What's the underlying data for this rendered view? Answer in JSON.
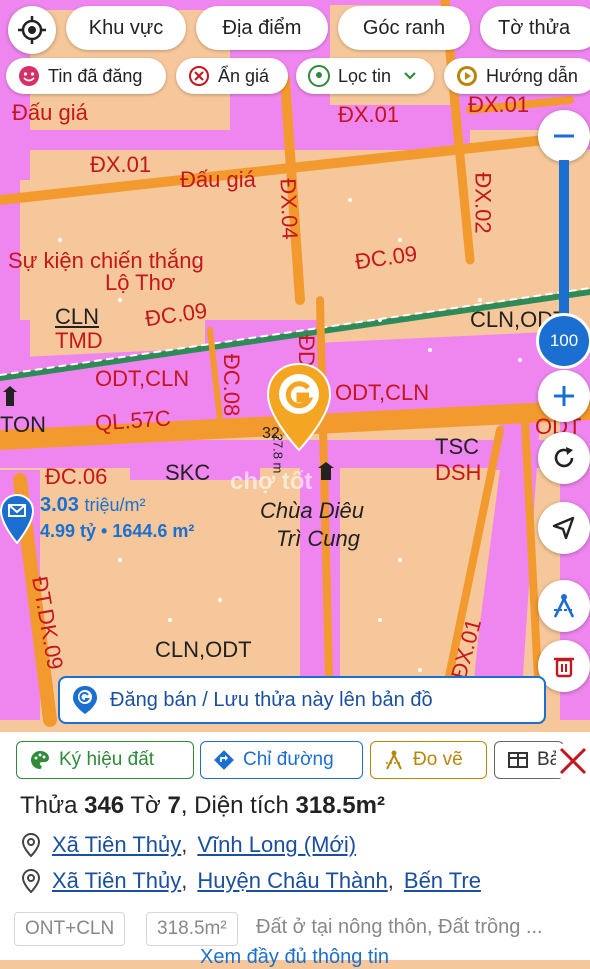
{
  "top_chips": [
    "Khu vực",
    "Địa điểm",
    "Góc ranh",
    "Tờ thửa"
  ],
  "sub_chips": [
    "Tin đã đăng",
    "Ẩn giá",
    "Lọc tin",
    "Hướng dẫn"
  ],
  "zoom_level": "100",
  "map_labels": {
    "dau_gia_1": "Đấu giá",
    "dau_gia_2": "Đấu giá",
    "dx01_a": "ĐX.01",
    "dx01_b": "ĐX.01",
    "dx01_c": "ĐX.01",
    "dx01_d": "ĐX.01",
    "dx02": "ĐX.02",
    "dx04": "ĐX.04",
    "dc09_a": "ĐC.09",
    "dc09_b": "ĐC.09",
    "dc08": "ĐC.08",
    "dc06": "ĐC.06",
    "dd": "ĐD",
    "su_kien": "Sự kiện chiến thắng",
    "lo_tho": "Lộ Thơ",
    "cln": "CLN",
    "tmd": "TMD",
    "cln_odt_1": "CLN,ODT",
    "cln_odt_2": "CLN,ODT",
    "odt_cln_1": "ODT,CLN",
    "odt_cln_2": "ODT,CLN",
    "odt": "ODT",
    "ql57c": "QL.57C",
    "ton": "TON",
    "tsc": "TSC",
    "dsh": "DSH",
    "skc": "SKC",
    "chua_1": "Chùa Diêu",
    "chua_2": "Trì Cung",
    "dtdk09": "ĐT.DK.09",
    "parcel_no": "32",
    "parcel_area_text": "27.8 m"
  },
  "price_marker": {
    "price": "3.03",
    "unit": "triệu/m²",
    "detail": "4.99 tỷ • 1644.6 m²"
  },
  "watermark": "chợ tốt",
  "post_banner": "Đăng bán / Lưu thửa này lên bản đồ",
  "tabs": [
    "Ký hiệu đất",
    "Chỉ đường",
    "Đo vẽ",
    "Bả"
  ],
  "parcel": {
    "thua_label": "Thửa",
    "thua": "346",
    "to_label": "Tờ",
    "to": "7",
    "dien_tich_label": "Diện tích",
    "dien_tich": "318.5m²"
  },
  "address_new": {
    "commune": "Xã Tiên Thủy",
    "province": "Vĩnh Long (Mới)"
  },
  "address_old": {
    "commune": "Xã Tiên Thủy",
    "district": "Huyện Châu Thành",
    "province": "Bến Tre"
  },
  "land_tags": [
    "ONT+CLN",
    "318.5m²"
  ],
  "land_desc": "Đất ở tại nông thôn, Đất trồng ...",
  "more_link": "Xem đầy đủ thông tin",
  "colors": {
    "accent": "#1a6fd1",
    "green": "#2f8a3a",
    "pink": "#ee82ee",
    "road": "#f39a2e",
    "land": "#f6c79a",
    "marker": "#f4a623"
  }
}
